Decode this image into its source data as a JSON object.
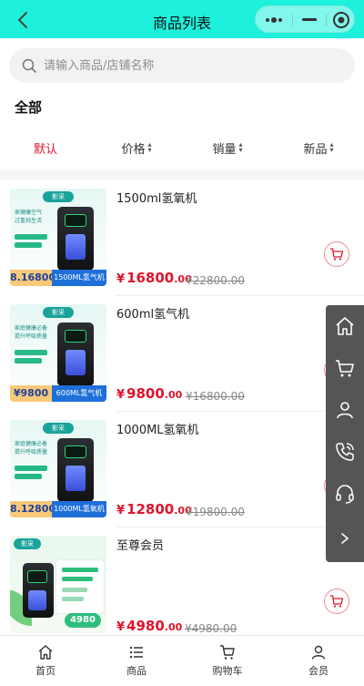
{
  "nav": {
    "title": "商品列表"
  },
  "search": {
    "placeholder": "请输入商品/店铺名称"
  },
  "category": {
    "label": "全部"
  },
  "sort": [
    {
      "label": "默认",
      "active": true
    },
    {
      "label": "价格",
      "active": false
    },
    {
      "label": "销量",
      "active": false
    },
    {
      "label": "新品",
      "active": false
    }
  ],
  "products": [
    {
      "name": "1500ml氢氧机",
      "currency": "¥",
      "price_int": "16800",
      "price_dec": ".00",
      "old_price": "¥22800.00",
      "image_price": "8.16800",
      "image_model": "1500ML氢气机",
      "brand": "影采"
    },
    {
      "name": "600ml氢气机",
      "currency": "¥",
      "price_int": "9800",
      "price_dec": ".00",
      "old_price": "¥16800.00",
      "image_price": "¥9800",
      "image_model": "600ML氢气机",
      "brand": "影采"
    },
    {
      "name": "1000ML氢氧机",
      "currency": "¥",
      "price_int": "12800",
      "price_dec": ".00",
      "old_price": "¥19800.00",
      "image_price": "8.12800",
      "image_model": "1000ML氢氧机",
      "brand": "影采"
    },
    {
      "name": "至尊会员",
      "currency": "¥",
      "price_int": "4980",
      "price_dec": ".00",
      "old_price": "¥4980.00",
      "image_price": "4980",
      "brand": "影采"
    }
  ],
  "tabbar": [
    {
      "label": "首页",
      "icon": "home-icon"
    },
    {
      "label": "商品",
      "icon": "list-icon"
    },
    {
      "label": "购物车",
      "icon": "cart-icon"
    },
    {
      "label": "会员",
      "icon": "user-icon"
    }
  ],
  "floating_menu": [
    "home-icon",
    "cart-icon",
    "user-icon",
    "phone-icon",
    "customer-service-icon",
    "chevron-right-icon"
  ],
  "colors": {
    "nav_bg": "#1df0db",
    "accent": "#e0142b",
    "float_bar": "#555555"
  }
}
